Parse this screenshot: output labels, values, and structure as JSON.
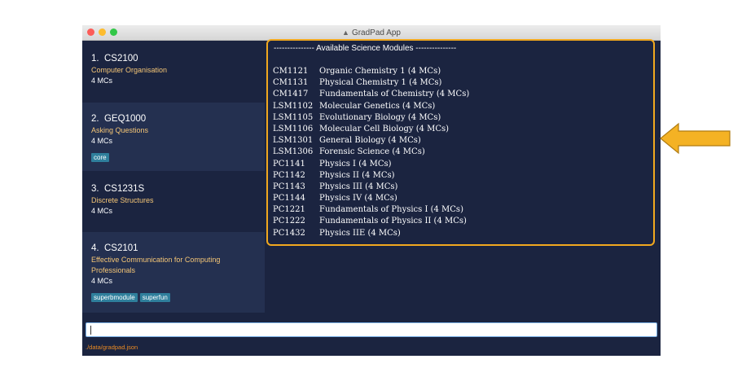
{
  "window": {
    "title": "GradPad App"
  },
  "modules": [
    {
      "index": "1.",
      "code": "CS2100",
      "name": "Computer Organisation",
      "credits": "4 MCs",
      "tags": []
    },
    {
      "index": "2.",
      "code": "GEQ1000",
      "name": "Asking Questions",
      "credits": "4 MCs",
      "tags": [
        "core"
      ]
    },
    {
      "index": "3.",
      "code": "CS1231S",
      "name": "Discrete Structures",
      "credits": "4 MCs",
      "tags": []
    },
    {
      "index": "4.",
      "code": "CS2101",
      "name_line1": "Effective Communication for Computing",
      "name_line2": "Professionals",
      "credits": "4 MCs",
      "tags": [
        "superbmodule",
        "superfun"
      ]
    }
  ],
  "result_display": {
    "header": "--------------- Available Science Modules ---------------",
    "rows": [
      {
        "code": "CM1121",
        "desc": "Organic Chemistry 1 (4 MCs)"
      },
      {
        "code": "CM1131",
        "desc": "Physical Chemistry 1 (4 MCs)"
      },
      {
        "code": "CM1417",
        "desc": "Fundamentals of Chemistry (4 MCs)"
      },
      {
        "code": "LSM1102",
        "desc": "Molecular Genetics (4 MCs)"
      },
      {
        "code": "LSM1105",
        "desc": "Evolutionary Biology (4 MCs)"
      },
      {
        "code": "LSM1106",
        "desc": "Molecular Cell Biology (4 MCs)"
      },
      {
        "code": "LSM1301",
        "desc": "General Biology (4 MCs)"
      },
      {
        "code": "LSM1306",
        "desc": "Forensic Science (4 MCs)"
      },
      {
        "code": "PC1141",
        "desc": "Physics I (4 MCs)"
      },
      {
        "code": "PC1142",
        "desc": "Physics II (4 MCs)"
      },
      {
        "code": "PC1143",
        "desc": "Physics III (4 MCs)"
      },
      {
        "code": "PC1144",
        "desc": "Physics IV (4 MCs)"
      },
      {
        "code": "PC1221",
        "desc": "Fundamentals of Physics I (4 MCs)"
      },
      {
        "code": "PC1222",
        "desc": "Fundamentals of Physics II (4 MCs)"
      },
      {
        "code": "PC1432",
        "desc": "Physics IIE (4 MCs)"
      }
    ]
  },
  "command_box": {
    "value": ""
  },
  "status_bar": {
    "path": "./data/gradpad.json"
  },
  "colors": {
    "background": "#1b2440",
    "highlight": "#f1a81f",
    "module_name": "#f5c676",
    "tag": "#2f7f9c",
    "status": "#e98a23"
  },
  "icons": {
    "title_icon": "graduation-cap-icon",
    "annotation_arrow": "left-arrow-icon"
  }
}
